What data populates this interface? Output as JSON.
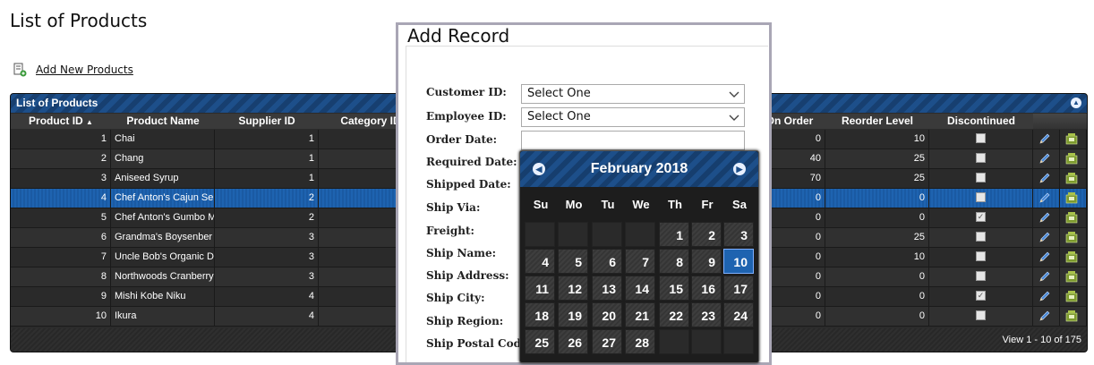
{
  "page": {
    "title": "List of Products",
    "add_link": "Add New Products"
  },
  "grid": {
    "caption": "List of Products",
    "columns": [
      "Product ID",
      "Product Name",
      "Supplier ID",
      "Category ID",
      "On Order",
      "Reorder Level",
      "Discontinued"
    ],
    "rows": [
      {
        "id": "1",
        "name": "Chai",
        "supplier": "1",
        "on_order": "0",
        "reorder": "10",
        "disc": false
      },
      {
        "id": "2",
        "name": "Chang",
        "supplier": "1",
        "on_order": "40",
        "reorder": "25",
        "disc": false
      },
      {
        "id": "3",
        "name": "Aniseed Syrup",
        "supplier": "1",
        "on_order": "70",
        "reorder": "25",
        "disc": false
      },
      {
        "id": "4",
        "name": "Chef Anton's Cajun Se",
        "supplier": "2",
        "on_order": "0",
        "reorder": "0",
        "disc": false
      },
      {
        "id": "5",
        "name": "Chef Anton's Gumbo M",
        "supplier": "2",
        "on_order": "0",
        "reorder": "0",
        "disc": true
      },
      {
        "id": "6",
        "name": "Grandma's Boysenber",
        "supplier": "3",
        "on_order": "0",
        "reorder": "25",
        "disc": false
      },
      {
        "id": "7",
        "name": "Uncle Bob's Organic D",
        "supplier": "3",
        "on_order": "0",
        "reorder": "10",
        "disc": false
      },
      {
        "id": "8",
        "name": "Northwoods Cranberry",
        "supplier": "3",
        "on_order": "0",
        "reorder": "0",
        "disc": false
      },
      {
        "id": "9",
        "name": "Mishi Kobe Niku",
        "supplier": "4",
        "on_order": "0",
        "reorder": "0",
        "disc": true
      },
      {
        "id": "10",
        "name": "Ikura",
        "supplier": "4",
        "on_order": "0",
        "reorder": "0",
        "disc": false
      }
    ],
    "selected_row": 3,
    "pager_info": "View 1 - 10 of 175"
  },
  "dialog": {
    "title": "Add Record",
    "labels": {
      "customer": "Customer ID:",
      "employee": "Employee ID:",
      "order_date": "Order Date:",
      "required_date": "Required Date:",
      "shipped_date": "Shipped Date:",
      "ship_via": "Ship Via:",
      "freight": "Freight:",
      "ship_name": "Ship Name:",
      "ship_address": "Ship Address:",
      "ship_city": "Ship City:",
      "ship_region": "Ship Region:",
      "ship_postal": "Ship Postal Code:"
    },
    "customer_value": "Select One",
    "employee_value": "Select One"
  },
  "calendar": {
    "title": "February 2018",
    "weekdays": [
      "Su",
      "Mo",
      "Tu",
      "We",
      "Th",
      "Fr",
      "Sa"
    ],
    "first_weekday": 4,
    "days_in_month": 28,
    "selected_day": 10
  },
  "colors": {
    "accent": "#1d4f8a",
    "selected": "#1e63b0",
    "grid_bg": "#2b2b2b"
  }
}
